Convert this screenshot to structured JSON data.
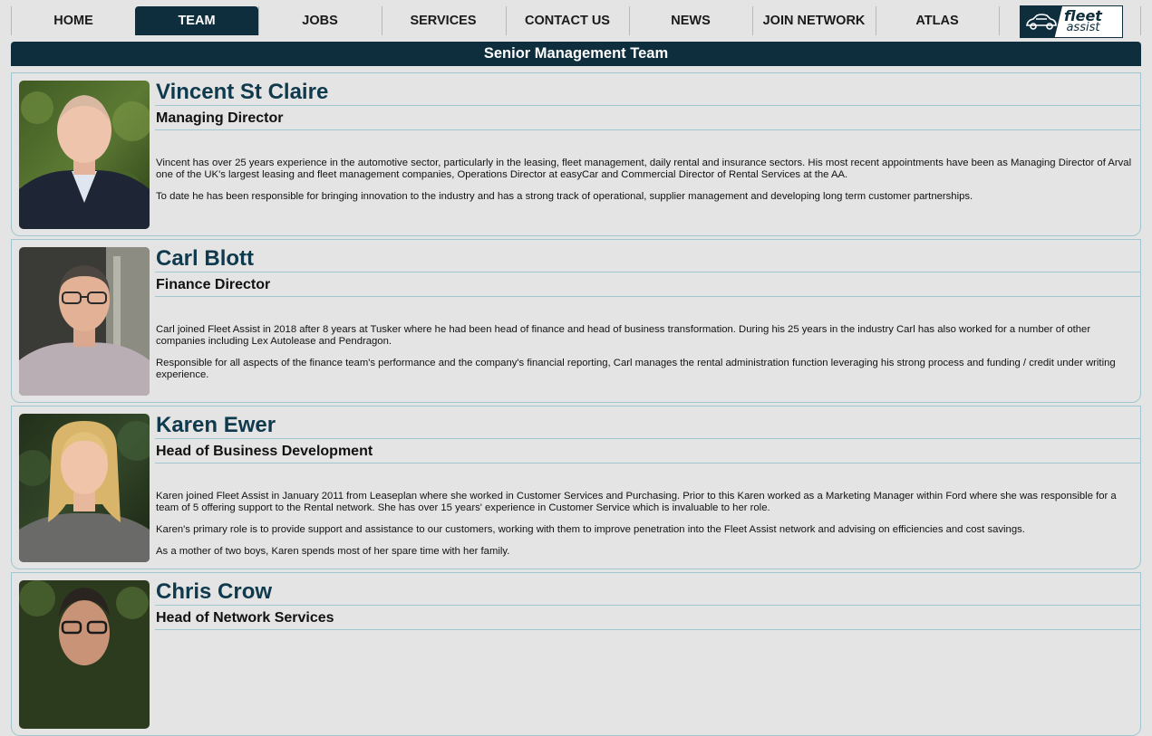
{
  "nav": {
    "items": [
      {
        "label": "HOME",
        "active": false
      },
      {
        "label": "TEAM",
        "active": true
      },
      {
        "label": "JOBS",
        "active": false
      },
      {
        "label": "SERVICES",
        "active": false
      },
      {
        "label": "CONTACT US",
        "active": false
      },
      {
        "label": "NEWS",
        "active": false
      },
      {
        "label": "JOIN NETWORK",
        "active": false
      },
      {
        "label": "ATLAS",
        "active": false
      }
    ],
    "logo": {
      "line1": "fleet",
      "line2": "assist",
      "icon": "car-icon"
    }
  },
  "section": {
    "title": "Senior Management Team"
  },
  "team": [
    {
      "name": "Vincent St Claire",
      "role": "Managing Director",
      "bio": [
        "Vincent has over 25 years experience in the automotive sector, particularly in the leasing, fleet management, daily rental and insurance sectors. His most recent appointments have been as Managing Director of Arval one of the UK's largest leasing and fleet management companies, Operations Director at easyCar and Commercial Director of Rental Services at the AA.",
        "To date he has been responsible for bringing innovation to the industry and has a strong track of operational, supplier management and developing long term customer partnerships."
      ]
    },
    {
      "name": "Carl Blott",
      "role": "Finance Director",
      "bio": [
        "Carl joined Fleet Assist in 2018 after 8 years at Tusker where he had been head of finance and head of business transformation. During his 25 years in the industry Carl has also worked for a number of other companies including Lex Autolease and Pendragon.",
        "Responsible for all aspects of the finance team's performance and the company's financial reporting, Carl manages the rental administration function leveraging his strong process and funding / credit under writing experience."
      ]
    },
    {
      "name": "Karen Ewer",
      "role": "Head of Business Development",
      "bio": [
        "Karen joined Fleet Assist in January 2011 from Leaseplan where she worked in Customer Services and Purchasing. Prior to this Karen worked as a Marketing Manager within Ford where she was responsible for a team of 5 offering support to the Rental network. She has over 15 years' experience in Customer Service which is invaluable to her role.",
        "Karen's primary role is to provide support and assistance to our customers, working with them to improve penetration into the Fleet Assist network and advising on efficiencies and cost savings.",
        "As a mother of two boys, Karen spends most of her spare time with her family."
      ]
    },
    {
      "name": "Chris Crow",
      "role": "Head of Network Services",
      "bio": []
    }
  ]
}
